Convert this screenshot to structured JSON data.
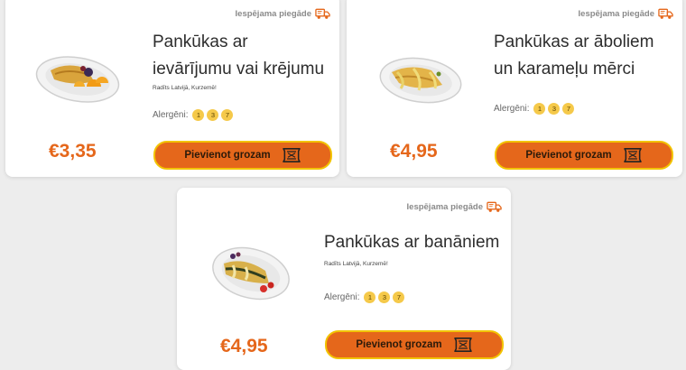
{
  "colors": {
    "accent": "#e5671b",
    "button_border": "#f2c300",
    "allergen_badge": "#f5c94a"
  },
  "delivery_badge": {
    "label": "Iespējama piegāde",
    "icon": "delivery-truck-icon"
  },
  "allergen_label": "Alergēni:",
  "cart_button_label": "Pievienot grozam",
  "cart_icon": "cart-icon",
  "products": [
    {
      "title_lines": [
        "Pankūkas ar",
        "ievārījumu vai krējumu"
      ],
      "origin": "Radīts Latvijā, Kurzemē!",
      "allergens": [
        "1",
        "3",
        "7"
      ],
      "price": "€3,35"
    },
    {
      "title_lines": [
        "Pankūkas ar āboliem",
        "un karameļu mērci"
      ],
      "origin": "",
      "allergens": [
        "1",
        "3",
        "7"
      ],
      "price": "€4,95"
    },
    {
      "title_lines": [
        "Pankūkas ar banāniem"
      ],
      "origin": "Radīts Latvijā, Kurzemē!",
      "allergens": [
        "1",
        "3",
        "7"
      ],
      "price": "€4,95"
    }
  ]
}
